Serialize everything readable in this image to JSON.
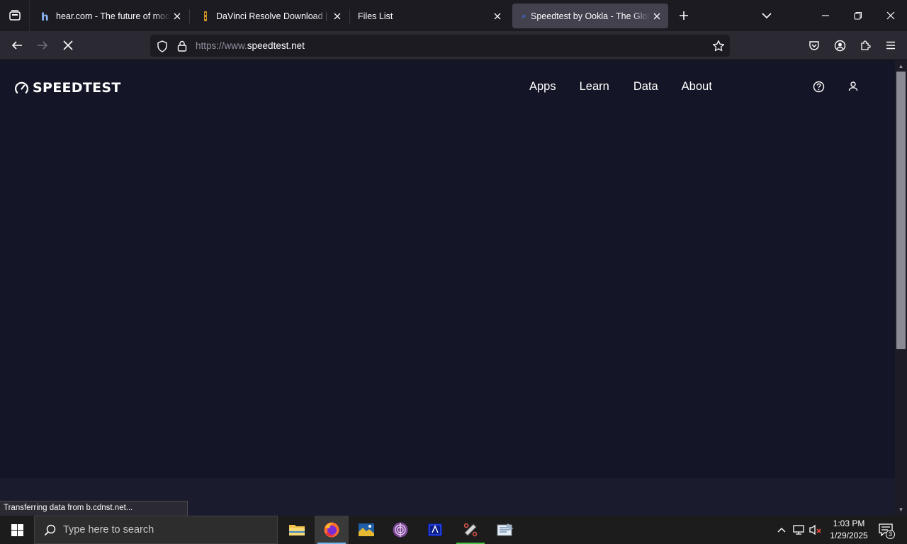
{
  "browser": {
    "tabs": [
      {
        "title": "hear.com - The future of modern hearing",
        "active": false
      },
      {
        "title": "DaVinci Resolve Download | Blackmagic",
        "active": false
      },
      {
        "title": "Files List",
        "active": false
      },
      {
        "title": "Speedtest by Ookla - The Global Broadband",
        "active": true
      }
    ],
    "url": {
      "scheme": "https://www.",
      "domain": "speedtest.net"
    },
    "status_text": "Transferring data from b.cdnst.net..."
  },
  "site": {
    "logo_text": "SPEEDTEST",
    "nav": [
      "Apps",
      "Learn",
      "Data",
      "About"
    ],
    "colors": {
      "background": "#141526",
      "footer_band": "#1a1b2c"
    }
  },
  "taskbar": {
    "search_placeholder": "Type here to search",
    "apps": [
      "file-explorer-icon",
      "firefox-icon",
      "photo-app-icon",
      "tor-browser-icon",
      "blue-app-icon",
      "snipping-tool-icon",
      "notepad-app-icon"
    ],
    "clock": {
      "time": "1:03 PM",
      "date": "1/29/2025"
    },
    "notifications_count": "3"
  }
}
